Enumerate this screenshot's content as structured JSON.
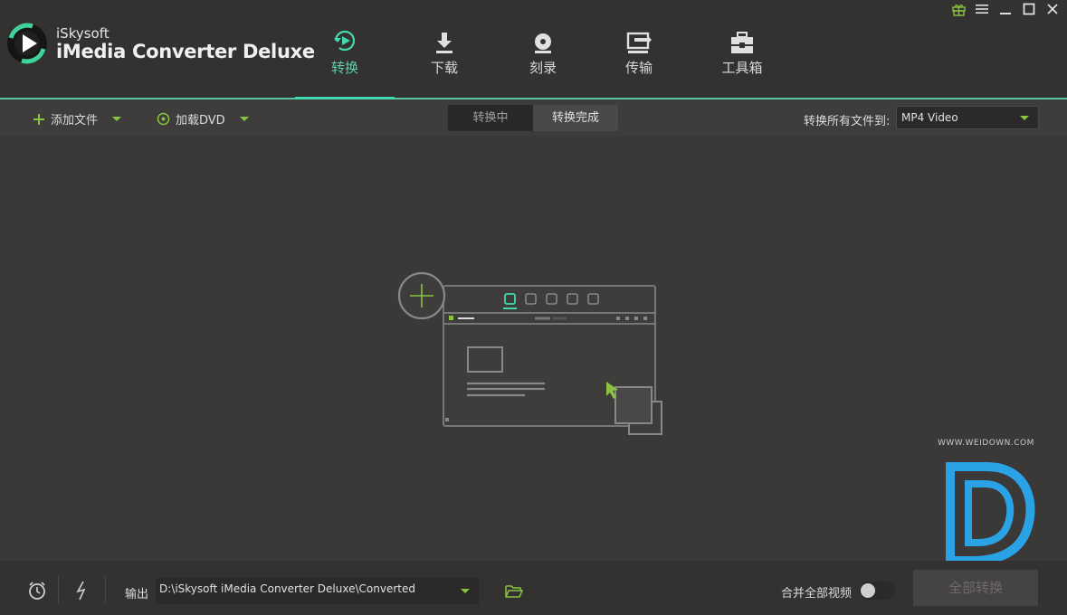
{
  "app": {
    "brand_small": "iSkysoft",
    "brand_big": "iMedia Converter Deluxe"
  },
  "tabs": [
    {
      "label": "转换",
      "icon": "convert-icon",
      "active": true
    },
    {
      "label": "下载",
      "icon": "download-icon",
      "active": false
    },
    {
      "label": "刻录",
      "icon": "burn-disc-icon",
      "active": false
    },
    {
      "label": "传输",
      "icon": "transfer-icon",
      "active": false
    },
    {
      "label": "工具箱",
      "icon": "toolbox-icon",
      "active": false
    }
  ],
  "window_controls": [
    "gift-icon",
    "menu-icon",
    "minimize-icon",
    "maximize-icon",
    "close-icon"
  ],
  "toolbar": {
    "add_files": "添加文件",
    "load_dvd": "加载DVD",
    "segment": [
      "转换中",
      "转换完成"
    ],
    "convert_all_to_label": "转换所有文件到:",
    "format_value": "MP4 Video"
  },
  "footer": {
    "output_label": "输出",
    "output_path": "D:\\iSkysoft iMedia Converter Deluxe\\Converted",
    "merge_label": "合并全部视频",
    "convert_all_button": "全部转换"
  },
  "watermark": {
    "text": "WWW.WEIDOWN.COM"
  },
  "colors": {
    "accent_teal": "#43d9b0",
    "accent_green": "#8ac43f",
    "background": "#3b3838",
    "header_bg": "#343131"
  }
}
